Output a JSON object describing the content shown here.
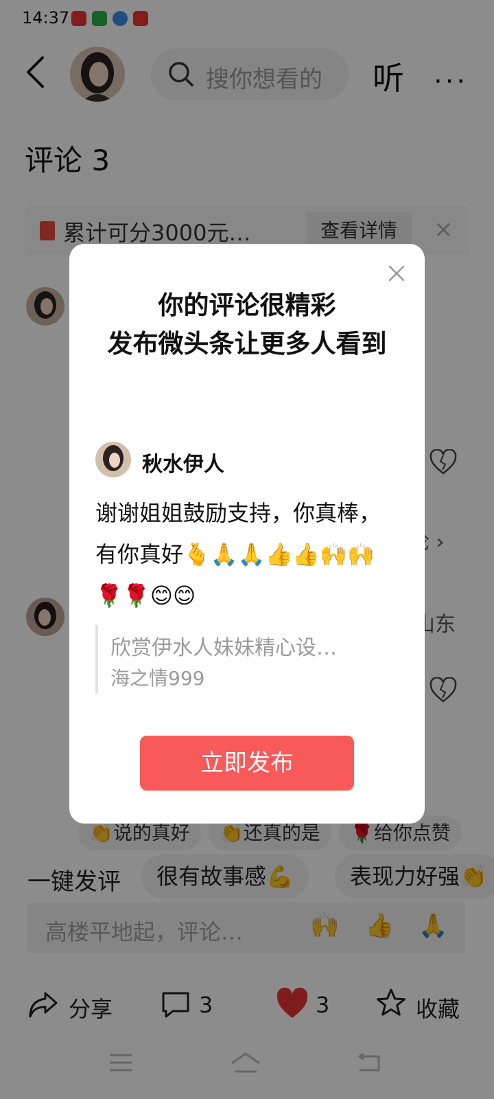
{
  "status_bar": {
    "time": "14:37"
  },
  "header": {
    "search_placeholder": "搜你想看的",
    "listen_label": "听",
    "more_label": "···"
  },
  "page": {
    "title": "评论 3"
  },
  "banner": {
    "text": "累计可分3000元…",
    "button_label": "查看详情",
    "close_label": "×"
  },
  "background_peeks": {
    "comma": "，",
    "chevron": "论 ›",
    "location": "山东"
  },
  "reply_chips": [
    {
      "emoji": "👏",
      "label": "说的真好"
    },
    {
      "emoji": "👏",
      "label": "还真的是"
    },
    {
      "emoji": "🌹",
      "label": "给你点赞"
    }
  ],
  "quick_comment": {
    "label": "一键发评",
    "chips": [
      "很有故事感💪",
      "表现力好强👏"
    ]
  },
  "comment_input": {
    "placeholder": "高楼平地起，评论…",
    "emojis": [
      "🙌",
      "👍",
      "🙏"
    ]
  },
  "actions": {
    "share_label": "分享",
    "comment_count": "3",
    "like_count": "3",
    "favorite_label": "收藏"
  },
  "modal": {
    "title_line1": "你的评论很精彩",
    "title_line2": "发布微头条让更多人看到",
    "author_name": "秋水伊人",
    "comment_text": "谢谢姐姐鼓励支持，你真棒，有你真好🫰🙏🙏👍👍🙌🙌🌹🌹😊😊",
    "quote_text": "欣赏伊水人妹妹精心设…",
    "quote_author": "海之情999",
    "publish_label": "立即发布"
  },
  "colors": {
    "accent_red": "#f85959",
    "heart_red": "#e83535",
    "overlay": "rgba(0,0,0,0.45)"
  }
}
